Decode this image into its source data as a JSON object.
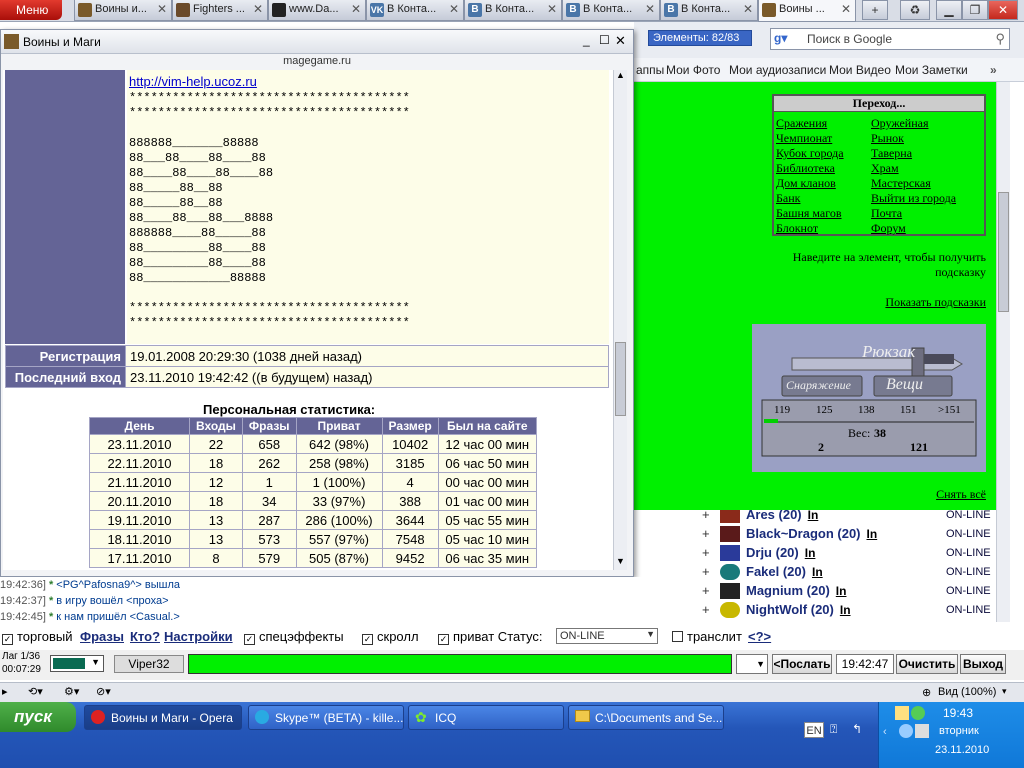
{
  "browser": {
    "menu_label": "Меню",
    "tabs": [
      {
        "label": "Воины и..."
      },
      {
        "label": "Fighters ..."
      },
      {
        "label": "www.Da..."
      },
      {
        "label": "В Конта..."
      },
      {
        "label": "В Конта..."
      },
      {
        "label": "В Конта..."
      },
      {
        "label": "В Конта..."
      },
      {
        "label": "Воины ..."
      }
    ],
    "elements_badge": "Элементы: 82/83",
    "search_placeholder": "Поиск в Google",
    "vk_links": [
      "аппы",
      "Мои Фото",
      "Мои аудиозаписи",
      "Мои Видео",
      "Мои Заметки"
    ],
    "status_zoom": "Вид (100%)"
  },
  "game_page": {
    "goto_title": "Переход...",
    "goto_left": [
      "Сражения",
      "Чемпионат",
      "Кубок города",
      "Библиотека",
      "Дом кланов",
      "Банк",
      "Башня магов",
      "Блокнот"
    ],
    "goto_right": [
      "Оружейная",
      "Рынок",
      "Таверна",
      "Храм",
      "Мастерская",
      "Выйти из города",
      "Почта",
      "Форум"
    ],
    "hint_text": "Наведите на элемент, чтобы получить подсказку",
    "show_hints": "Показать подсказки",
    "backpack": {
      "title": "Рюкзак",
      "left_tab": "Снаряжение",
      "right_tab": "Вещи",
      "scale": [
        "119",
        "125",
        "138",
        "151",
        ">151"
      ],
      "weight_label": "Вес:",
      "weight_value": "38",
      "left_value": "2",
      "right_value": "121"
    },
    "take_all": "Снять всё"
  },
  "players": [
    {
      "name": "Ares (20)",
      "in": "In",
      "status": "ON-LINE"
    },
    {
      "name": "Black~Dragon (20)",
      "in": "In",
      "status": "ON-LINE"
    },
    {
      "name": "Drju (20)",
      "in": "In",
      "status": "ON-LINE"
    },
    {
      "name": "Fakel (20)",
      "in": "In",
      "status": "ON-LINE"
    },
    {
      "name": "Magnium (20)",
      "in": "In",
      "status": "ON-LINE"
    },
    {
      "name": "NightWolf (20)",
      "in": "In",
      "status": "ON-LINE"
    }
  ],
  "popup": {
    "title": "Воины и Маги",
    "url": "magegame.ru",
    "profile_link": "http://vim-help.ucoz.ru",
    "profile_text": "***************************************\n***************************************\n\n888888_______88888\n88___88____88____88\n88____88____88____88\n88_____88__88\n88_____88__88\n88____88___88___8888\n888888____88_____88\n88_________88____88\n88_________88____88\n88____________88888\n\n***************************************\n***************************************",
    "registration_label": "Регистрация",
    "registration_value": "19.01.2008 20:29:30 (1038 дней назад)",
    "last_login_label": "Последний вход",
    "last_login_value": "23.11.2010 19:42:42 ((в будущем) назад)",
    "stats_title": "Персональная статистика:",
    "stats_headers": [
      "День",
      "Входы",
      "Фразы",
      "Приват",
      "Размер",
      "Был на сайте"
    ],
    "stats_rows": [
      [
        "23.11.2010",
        "22",
        "658",
        "642 (98%)",
        "10402",
        "12 час 00 мин"
      ],
      [
        "22.11.2010",
        "18",
        "262",
        "258 (98%)",
        "3185",
        "06 час 50 мин"
      ],
      [
        "21.11.2010",
        "12",
        "1",
        "1 (100%)",
        "4",
        "00 час 00 мин"
      ],
      [
        "20.11.2010",
        "18",
        "34",
        "33 (97%)",
        "388",
        "01 час 00 мин"
      ],
      [
        "19.11.2010",
        "13",
        "287",
        "286 (100%)",
        "3644",
        "05 час 55 мин"
      ],
      [
        "18.11.2010",
        "13",
        "573",
        "557 (97%)",
        "7548",
        "05 час 10 мин"
      ],
      [
        "17.11.2010",
        "8",
        "579",
        "505 (87%)",
        "9452",
        "06 час 35 мин"
      ]
    ]
  },
  "chat": [
    {
      "time": "19:42:36]",
      "text": "<PG^Pafosna9^> вышла"
    },
    {
      "time": "19:42:37]",
      "text": "в игру вошёл <проха>"
    },
    {
      "time": "19:42:45]",
      "text": "к нам пришёл <Casual.>"
    }
  ],
  "options": {
    "trade": "торговый",
    "phrases": "Фразы",
    "who": "Кто?",
    "settings": "Настройки",
    "effects": "спецэффекты",
    "scroll": "скролл",
    "private_status": "приват Статус:",
    "status_value": "ON-LINE",
    "translit": "транслит",
    "help": "<?>"
  },
  "sendbar": {
    "page": "Лаг 1/36",
    "clock_small": "00:07:29",
    "nick": "Viper32",
    "send": "<Послать",
    "time": "19:42:47",
    "clear": "Очистить",
    "exit": "Выход"
  },
  "taskbar": {
    "start": "пуск",
    "items": [
      "Воины и Маги - Opera",
      "Skype™ (BETA) - kille...",
      "ICQ",
      "C:\\Documents and Se..."
    ],
    "lang": "EN",
    "time": "19:43",
    "weekday": "вторник",
    "date": "23.11.2010"
  },
  "colors": {
    "game_green": "#00f000",
    "profile_purple": "#646496",
    "profile_bg": "#fdfde8"
  }
}
